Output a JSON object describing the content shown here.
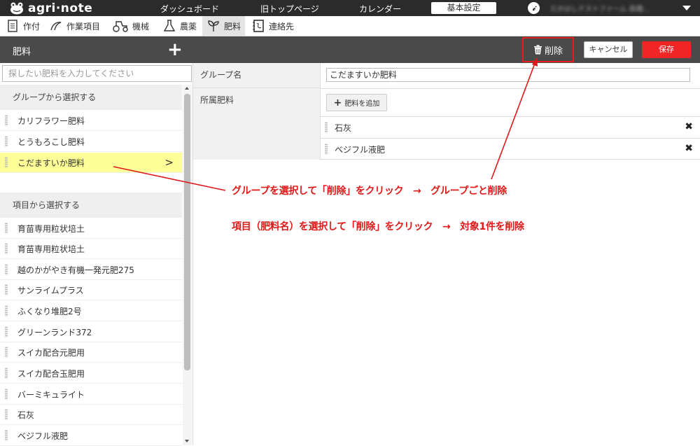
{
  "app": {
    "logo": "agri·note"
  },
  "topnav": {
    "links": [
      "ダッシュボード",
      "旧トップページ",
      "カレンダー"
    ],
    "settings_button": "基本設定",
    "user_name": "たかはしテストファーム 高橋..."
  },
  "subnav": {
    "items": [
      {
        "label": "作付",
        "icon": "document-icon"
      },
      {
        "label": "作業項目",
        "icon": "sickle-icon"
      },
      {
        "label": "機械",
        "icon": "tractor-icon"
      },
      {
        "label": "農薬",
        "icon": "flask-icon"
      },
      {
        "label": "肥料",
        "icon": "sprout-icon",
        "active": true
      },
      {
        "label": "連絡先",
        "icon": "address-book-icon"
      }
    ]
  },
  "header": {
    "title": "肥料",
    "add_icon": "+",
    "delete_label": "削除",
    "cancel_label": "キャンセル",
    "save_label": "保存"
  },
  "sidebar": {
    "search_placeholder": "探したい肥料を入力してください",
    "group_section_title": "グループから選択する",
    "groups": [
      "カリフラワー肥料",
      "とうもろこし肥料",
      "こだますいか肥料"
    ],
    "selected_group": "こだますいか肥料",
    "item_section_title": "項目から選択する",
    "items": [
      "育苗専用粒状培土",
      "育苗専用粒状培土",
      "越のかがやき有機一発元肥275",
      "サンライムプラス",
      "ふくなり堆肥2号",
      "グリーンランド372",
      "スイカ配合元肥用",
      "スイカ配合玉肥用",
      "バーミキュライト",
      "石灰",
      "ベジフル液肥"
    ]
  },
  "form": {
    "group_name_label": "グループ名",
    "group_name_value": "こだますいか肥料",
    "members_label": "所属肥料",
    "add_button_label": "肥料を追加",
    "members": [
      "石灰",
      "ベジフル液肥"
    ]
  },
  "annotations": {
    "line1": "グループを選択して「削除」をクリック　→　グループごと削除",
    "line2": "項目（肥料名）を選択して「削除」をクリック　→　対象1件を削除",
    "color": "#e01818"
  },
  "colors": {
    "topbar": "#2b2b2b",
    "headbar": "#4a4a4a",
    "save": "#f02525",
    "selected_row": "#ffff99"
  }
}
